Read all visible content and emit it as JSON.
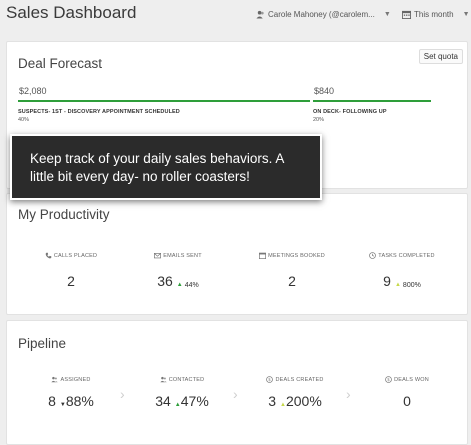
{
  "header": {
    "title": "Sales Dashboard",
    "user": "Carole Mahoney (@carolem...",
    "period": "This month"
  },
  "forecast": {
    "title": "Deal Forecast",
    "set_quota": "Set quota",
    "stages": [
      {
        "amount": "$2,080",
        "name": "SUSPECTS- 1ST - DISCOVERY APPOINTMENT SCHEDULED",
        "percent": "40%"
      },
      {
        "amount": "$840",
        "name": "ON DECK- FOLLOWING UP",
        "percent": "20%"
      }
    ]
  },
  "tooltip": {
    "text": "Keep track of your daily sales behaviors. A little bit every day- no roller coasters!"
  },
  "productivity": {
    "title": "My Productivity",
    "metrics": [
      {
        "label": "CALLS PLACED",
        "value": "2",
        "change": "",
        "icon": "phone-icon"
      },
      {
        "label": "EMAILS SENT",
        "value": "36",
        "change": "44%",
        "icon": "envelope-icon"
      },
      {
        "label": "MEETINGS BOOKED",
        "value": "2",
        "change": "",
        "icon": "calendar-icon"
      },
      {
        "label": "TASKS COMPLETED",
        "value": "9",
        "change": "800%",
        "icon": "clock-icon"
      }
    ]
  },
  "pipeline": {
    "title": "Pipeline",
    "metrics": [
      {
        "label": "ASSIGNED",
        "value": "8",
        "change": "88%",
        "direction": "down",
        "icon": "users-icon"
      },
      {
        "label": "CONTACTED",
        "value": "34",
        "change": "47%",
        "direction": "up",
        "icon": "users-icon"
      },
      {
        "label": "DEALS CREATED",
        "value": "3",
        "change": "200%",
        "direction": "up",
        "icon": "dollar-circle-icon"
      },
      {
        "label": "DEALS WON",
        "value": "0",
        "change": "",
        "direction": "",
        "icon": "dollar-circle-icon"
      }
    ]
  }
}
